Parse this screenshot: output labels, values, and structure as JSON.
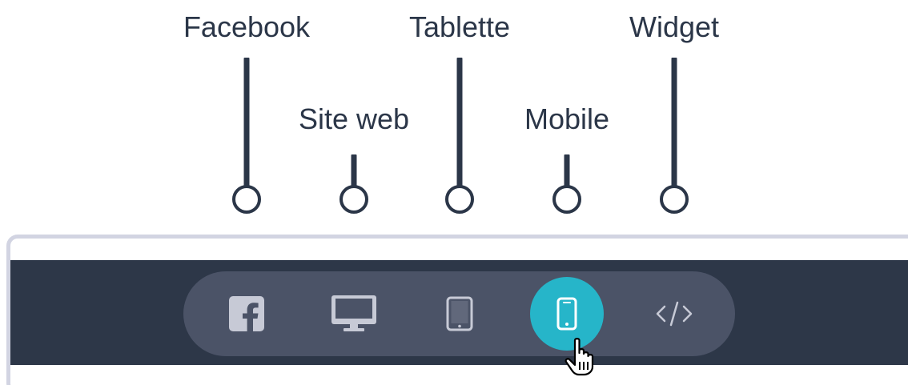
{
  "callouts": [
    {
      "id": "facebook",
      "label": "Facebook"
    },
    {
      "id": "website",
      "label": "Site web"
    },
    {
      "id": "tablet",
      "label": "Tablette"
    },
    {
      "id": "mobile",
      "label": "Mobile"
    },
    {
      "id": "widget",
      "label": "Widget"
    }
  ],
  "toolbar": {
    "buttons": [
      {
        "id": "facebook",
        "icon": "facebook-icon",
        "active": false
      },
      {
        "id": "website",
        "icon": "desktop-icon",
        "active": false
      },
      {
        "id": "tablet",
        "icon": "tablet-icon",
        "active": false
      },
      {
        "id": "mobile",
        "icon": "mobile-icon",
        "active": true
      },
      {
        "id": "widget",
        "icon": "code-icon",
        "active": false
      }
    ],
    "active_color": "#26b5c9",
    "bar_color": "#2d3748",
    "pill_color": "#4b5367"
  },
  "cursor": {
    "icon": "hand-pointer-icon"
  }
}
